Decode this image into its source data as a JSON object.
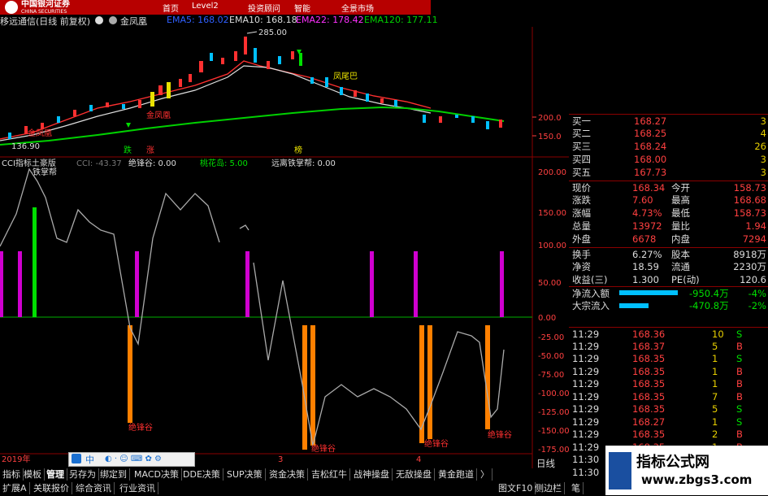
{
  "header": {
    "brand_cn": "中国银河证券",
    "brand_en": "CHINA SECURITIES",
    "nav": [
      "首页",
      "Level2",
      "投资顾问",
      "智能",
      "全景市场"
    ]
  },
  "titlebar": {
    "stock": "移远通信(日线 前复权)",
    "pattern": "金凤凰",
    "ema5": "EMA5: 168.02",
    "ema10": "EMA10: 168.18",
    "ema22": "EMA22: 178.42",
    "ema120": "EMA120: 177.11"
  },
  "price_chart": {
    "high_label": "285.00",
    "low_label": "136.90",
    "left_tag": "金凤凰",
    "mid_tag": "金凤凰",
    "right_tag": "凤尾巴",
    "axis_200": "200.0",
    "axis_150": "150.0",
    "marks": [
      "跌",
      "涨",
      "榜"
    ]
  },
  "indicator": {
    "name": "CCI指标土豪版",
    "cci": "CCI: -43.37",
    "jt": "绝锋谷: 0.00",
    "thd": "桃花岛: 5.00",
    "yljz": "远离铁掌帮: 0.00",
    "top_tag": "铁掌帮",
    "axis": [
      "200.00",
      "150.00",
      "100.00",
      "50.00",
      "0.00",
      "-25.00",
      "-50.00",
      "-75.00",
      "-100.00",
      "-125.00",
      "-150.00",
      "-175.00"
    ],
    "bottom_tags": [
      "绝锋谷",
      "绝锋谷",
      "绝锋谷",
      "绝锋谷"
    ],
    "date_left": "2019年",
    "date_mid": "3",
    "date_right": "4"
  },
  "quote": {
    "asks": [
      {
        "label": "买一",
        "price": "168.27",
        "vol": "3"
      },
      {
        "label": "买二",
        "price": "168.25",
        "vol": "4"
      },
      {
        "label": "买三",
        "price": "168.24",
        "vol": "26"
      },
      {
        "label": "买四",
        "price": "168.00",
        "vol": "3"
      },
      {
        "label": "买五",
        "price": "167.73",
        "vol": "3"
      }
    ],
    "stats": [
      {
        "l1": "现价",
        "v1": "168.34",
        "l2": "今开",
        "v2": "158.73"
      },
      {
        "l1": "涨跌",
        "v1": "7.60",
        "l2": "最高",
        "v2": "168.68"
      },
      {
        "l1": "涨幅",
        "v1": "4.73%",
        "l2": "最低",
        "v2": "158.73"
      },
      {
        "l1": "总量",
        "v1": "13972",
        "l2": "量比",
        "v2": "1.94"
      },
      {
        "l1": "外盘",
        "v1": "6678",
        "l2": "内盘",
        "v2": "7294"
      }
    ],
    "stats2": [
      {
        "l1": "换手",
        "v1": "6.27%",
        "l2": "股本",
        "v2": "8918万"
      },
      {
        "l1": "净资",
        "v1": "18.59",
        "l2": "流通",
        "v2": "2230万"
      },
      {
        "l1": "收益(三)",
        "v1": "1.300",
        "l2": "PE(动)",
        "v2": "120.6"
      }
    ],
    "flow": [
      {
        "label": "净流入额",
        "val": "-950.4万",
        "pct": "-4%",
        "bar": 0.85
      },
      {
        "label": "大宗流入",
        "val": "-470.8万",
        "pct": "-2%",
        "bar": 0.42
      }
    ],
    "ticks": [
      {
        "t": "11:29",
        "p": "168.36",
        "v": "10",
        "s": "S"
      },
      {
        "t": "11:29",
        "p": "168.37",
        "v": "5",
        "s": "B"
      },
      {
        "t": "11:29",
        "p": "168.35",
        "v": "1",
        "s": "S"
      },
      {
        "t": "11:29",
        "p": "168.35",
        "v": "1",
        "s": "B"
      },
      {
        "t": "11:29",
        "p": "168.35",
        "v": "1",
        "s": "B"
      },
      {
        "t": "11:29",
        "p": "168.35",
        "v": "7",
        "s": "B"
      },
      {
        "t": "11:29",
        "p": "168.35",
        "v": "5",
        "s": "S"
      },
      {
        "t": "11:29",
        "p": "168.27",
        "v": "1",
        "s": "S"
      },
      {
        "t": "11:29",
        "p": "168.35",
        "v": "2",
        "s": "B"
      },
      {
        "t": "11:29",
        "p": "168.35",
        "v": "1",
        "s": "B"
      },
      {
        "t": "11:30",
        "p": "168.35",
        "v": "1",
        "s": "B"
      },
      {
        "t": "11:30",
        "p": "168.34",
        "v": "1",
        "s": "S"
      }
    ],
    "period": "日线"
  },
  "bottom_tabs": {
    "row1": [
      "指标",
      "模板",
      "管理",
      "另存为",
      "绑定到",
      "MACD决策",
      "DDE决策",
      "SUP决策",
      "资金决策",
      "吉松红牛",
      "战神操盘",
      "无敌操盘",
      "黄金跑道",
      "〉"
    ],
    "row2": [
      "扩展A",
      "关联报价",
      "综合资讯",
      "行业资讯"
    ],
    "right": [
      "图文F10",
      "侧边栏",
      "笔"
    ]
  },
  "ime": {
    "label": "中"
  },
  "watermark": {
    "line1": "指标公式网",
    "line2": "www.zbgs3.com"
  }
}
